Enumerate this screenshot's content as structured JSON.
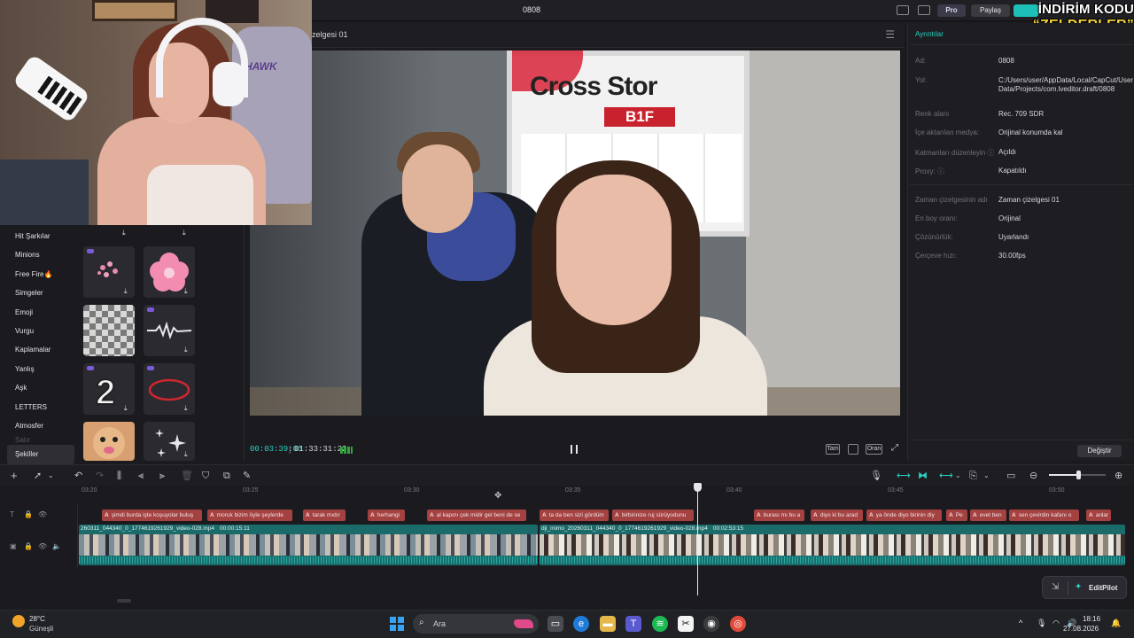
{
  "window": {
    "project_name": "0808"
  },
  "header": {
    "pro_label": "Pro",
    "share_label": "Paylaş"
  },
  "overlay_promo": {
    "line1": "İNDİRİM KODU",
    "line2": "“ZELDERLER”"
  },
  "webcam": {
    "chair_brand": "HAWK"
  },
  "preview": {
    "timeline_title": "zelgesi 01",
    "video_sign_text": "Cross Stor",
    "video_floor_label": "B1F",
    "current_time": "00:03:39:03",
    "total_time": "01:33:31:22",
    "buttons": {
      "full": "Tam",
      "ratio": "Oran"
    }
  },
  "left_panel": {
    "categories": [
      "Hit Şarkılar",
      "Minions",
      "Free Fire🔥",
      "Simgeler",
      "Emoji",
      "Vurgu",
      "Kaplamalar",
      "Yanlış",
      "Aşk",
      "LETTERS",
      "Atmosfer",
      "Satır",
      "Şekiller"
    ],
    "active_category": "Şekiller"
  },
  "details": {
    "header": "Ayrıntılar",
    "rows": [
      {
        "key": "Ad:",
        "value": "0808"
      },
      {
        "key": "Yol:",
        "value": "C:/Users/user/AppData/Local/CapCut/User Data/Projects/com.lveditor.draft/0808"
      },
      {
        "key": "Renk alanı",
        "value": "Rec. 709 SDR"
      },
      {
        "key": "İçe aktarılan medya:",
        "value": "Orijinal konumda kal"
      },
      {
        "key": "Katmanları düzenleyin ⓘ",
        "value": "Açıldı"
      },
      {
        "key": "Proxy: ⓘ",
        "value": "Kapatıldı"
      },
      {
        "key": "Zaman çizelgesinin adı",
        "value": "Zaman çizelgesi 01"
      },
      {
        "key": "En boy oranı:",
        "value": "Orijinal"
      },
      {
        "key": "Çözünürlük:",
        "value": "Uyarlandı"
      },
      {
        "key": "Çerçeve hızı:",
        "value": "30.00fps"
      }
    ],
    "change_button": "Değiştir"
  },
  "ruler": {
    "labels": [
      "03:20",
      "03:25",
      "03:30",
      "03:35",
      "03:40",
      "03:45",
      "03:50"
    ]
  },
  "captions": [
    "şimdi burda işte koşuyolar buluş",
    "moruk bizim öyle şeylerde",
    "tarak mıdır",
    "herhangi",
    "al kapını çek midir gel beni de se",
    "ta da ben sizi gördüm",
    "birbirinize ruj sürüyodunu",
    "burası mı bu a",
    "diyo ki bu arad",
    "ya önde diyo birinin diy",
    "Pe",
    "evet ben",
    "sen çevirdin kafanı o",
    "anlar"
  ],
  "video_clips": [
    {
      "file": "260311_044340_0_1774619261929_video-028.mp4",
      "duration": "00:00:15:11"
    },
    {
      "file": "dji_mimo_20260311_044340_0_1774619261929_video-028.mp4",
      "duration": "00:02:53:15"
    }
  ],
  "editpilot": {
    "label": "EditPilot"
  },
  "taskbar": {
    "weather_temp": "28°C",
    "weather_desc": "Güneşli",
    "search_placeholder": "Ara",
    "time": "18:16",
    "date": "27.08.2026"
  },
  "colors": {
    "accent": "#2ad0c4",
    "caption_clip": "#a44141",
    "video_clip": "#1a6b6a"
  }
}
